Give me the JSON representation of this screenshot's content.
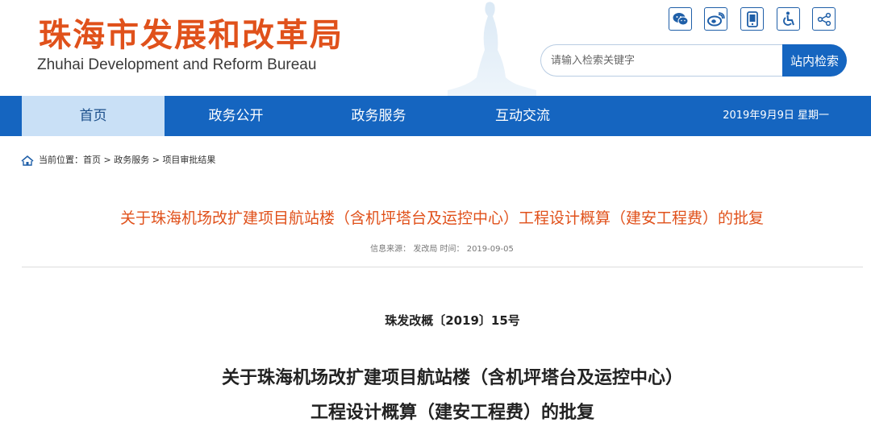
{
  "header": {
    "logo_cn": "珠海市发展和改革局",
    "logo_en": "Zhuhai Development and Reform Bureau",
    "share_icons": [
      "wechat-icon",
      "weibo-icon",
      "mobile-icon",
      "accessibility-icon",
      "share-icon"
    ],
    "search": {
      "placeholder": "请输入检索关键字",
      "button_label": "站内检索"
    }
  },
  "nav": {
    "items": [
      {
        "label": "首页",
        "active": true
      },
      {
        "label": "政务公开",
        "active": false
      },
      {
        "label": "政务服务",
        "active": false
      },
      {
        "label": "互动交流",
        "active": false
      }
    ],
    "date": "2019年9月9日 星期一"
  },
  "breadcrumb": {
    "prefix": "当前位置：",
    "items": [
      "首页",
      "政务服务",
      "项目审批结果"
    ],
    "separator": ">"
  },
  "article": {
    "title": "关于珠海机场改扩建项目航站楼（含机坪塔台及运控中心）工程设计概算（建安工程费）的批复",
    "meta": "信息来源：  发改局  时间：  2019-09-05",
    "doc_number": "珠发改概〔2019〕15号",
    "heading_line1": "关于珠海机场改扩建项目航站楼（含机坪塔台及运控中心）",
    "heading_line2": "工程设计概算（建安工程费）的批复"
  },
  "colors": {
    "brand_blue": "#1565c0",
    "nav_active_bg": "#c9e0f6",
    "title_orange": "#e0511b"
  }
}
